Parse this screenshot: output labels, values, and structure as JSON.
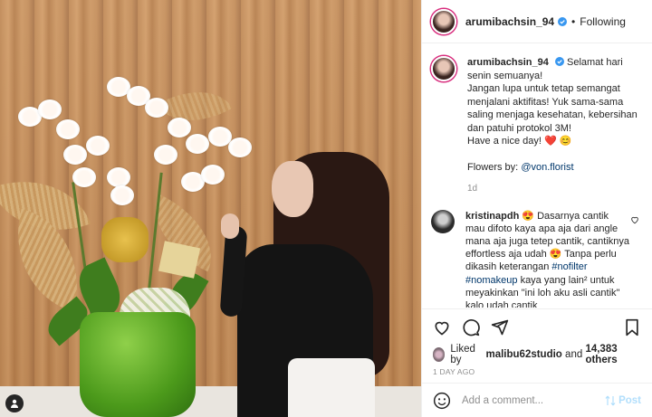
{
  "post": {
    "username": "arumibachsin_94",
    "follow_status": "Following",
    "separator": "•",
    "caption": {
      "author": "arumibachsin_94",
      "lines": [
        "Selamat hari senin semuanya!",
        "Jangan lupa untuk tetap semangat menjalani aktifitas! Yuk sama-sama saling menjaga kesehatan, kebersihan dan patuhi protokol 3M!",
        "Have a nice day! ❤️ 😊"
      ],
      "flowers_prefix": "Flowers by:",
      "flowers_mention": "@von.florist",
      "age": "1d"
    },
    "comment": {
      "author": "kristinapdh",
      "text_start": "😍 Dasarnya cantik mau difoto kaya apa aja dari angle mana aja juga tetep cantik, cantiknya effortless aja udah 😍 Tanpa perlu dikasih keterangan",
      "hashtags": "#nofilter #nomakeup",
      "text_end": "kaya yang lain² untuk meyakinkan \"ini loh aku asli cantik\" kalo udah cantik"
    },
    "likes": {
      "prefix": "Liked by",
      "user": "malibu62studio",
      "middle": "and",
      "count": "14,383 others"
    },
    "posted": "1 DAY AGO",
    "add_comment_placeholder": "Add a comment...",
    "post_button": "Post"
  },
  "icons": {
    "verified": "verified-badge-icon",
    "heart": "heart-icon",
    "comment": "comment-icon",
    "share": "share-icon",
    "save": "bookmark-icon",
    "emoji": "emoji-icon",
    "tag": "user-tag-icon"
  },
  "colors": {
    "link": "#00376b",
    "verified": "#3897f0",
    "muted": "#8e8e8e",
    "post_button": "#b2dffc"
  }
}
